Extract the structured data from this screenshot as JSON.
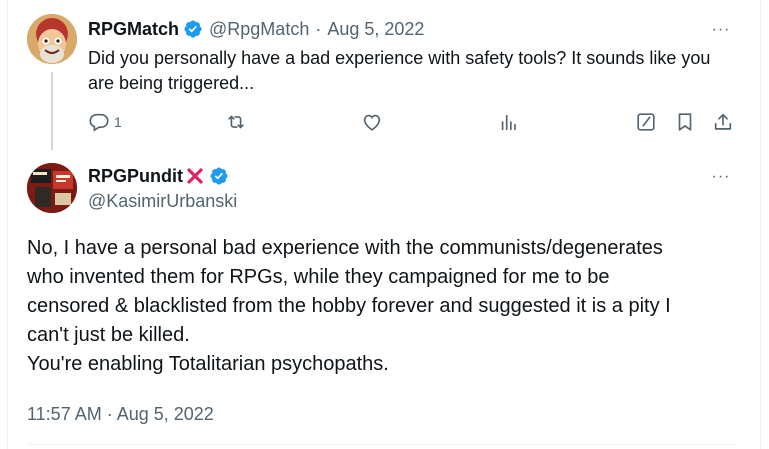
{
  "parent_tweet": {
    "display_name": "RPGMatch",
    "handle": "@RpgMatch",
    "separator": "·",
    "date": "Aug 5, 2022",
    "more_label": "···",
    "text": "Did you personally have a bad experience with safety tools?  It sounds like you are being triggered...",
    "reply_count": "1",
    "icons": {
      "reply": "reply-icon",
      "retweet": "retweet-icon",
      "like": "heart-icon",
      "views": "views-icon",
      "grok": "grok-icon",
      "bookmark": "bookmark-icon",
      "share": "share-icon"
    }
  },
  "main_tweet": {
    "display_name": "RPGPundit",
    "handle": "@KasimirUrbanski",
    "more_label": "···",
    "text_lines": [
      "No, I have a personal bad experience with the communists/degenerates",
      "who invented them for RPGs, while they campaigned for me to be",
      "censored & blacklisted from the hobby forever and suggested it is a pity I",
      "can't just be killed.",
      "You're enabling Totalitarian psychopaths."
    ],
    "timestamp": "11:57 AM · Aug 5, 2022"
  },
  "colors": {
    "text_primary": "#0f1419",
    "text_muted": "#536471",
    "verified_blue": "#1d9bf0",
    "cross_red": "#e0245e",
    "divider": "#eff3f4",
    "thread_line": "#cfd9de"
  }
}
